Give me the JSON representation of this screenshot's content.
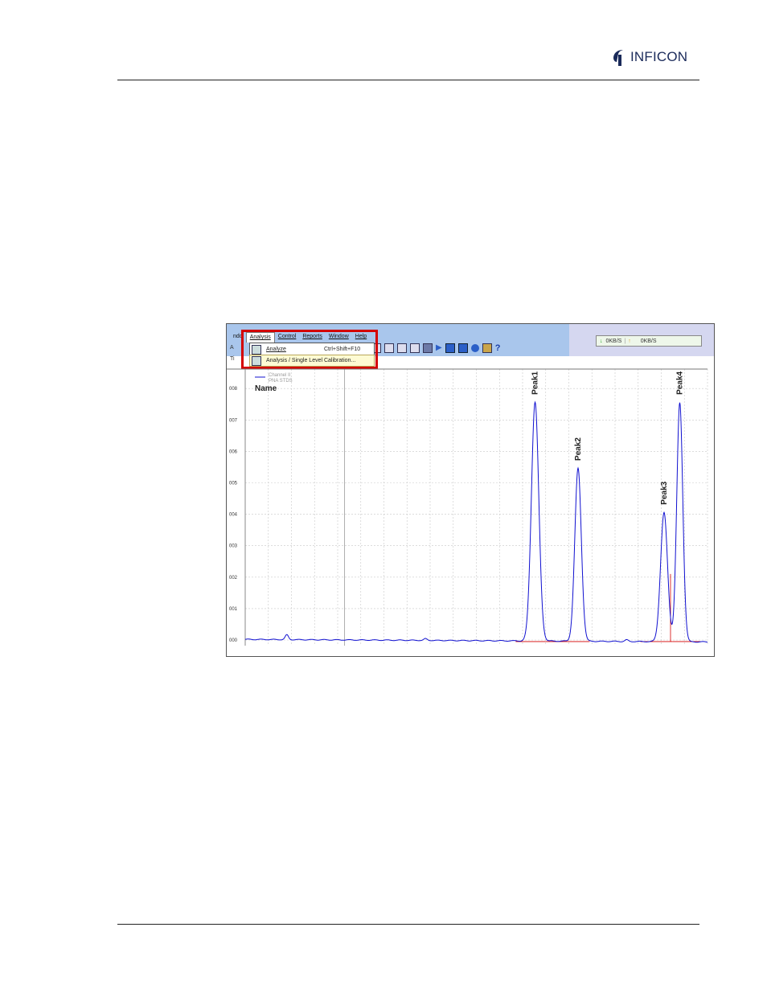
{
  "header": {
    "logo_text": "INFICON",
    "colors": {
      "logo_mark": "#1a2a5a",
      "rule": "#222222"
    }
  },
  "screenshot": {
    "menu": {
      "partial_left": "ndo",
      "items": [
        "Analysis",
        "Control",
        "Reports",
        "Window",
        "Help"
      ],
      "active_index": 0
    },
    "dropdown": {
      "items": [
        {
          "label": "Analyze",
          "shortcut": "Ctrl+Shift+F10",
          "icon": "analyze-icon"
        },
        {
          "label": "Analysis / Single Level Calibration...",
          "shortcut": "",
          "icon": "calibration-icon"
        }
      ],
      "selected_index": 1
    },
    "side_fragments": [
      "A",
      "Ti"
    ],
    "status": {
      "down_rate": "0KB/S",
      "up_rate": "0KB/S",
      "down_icon": "down-arrow-icon",
      "up_icon": "up-arrow-icon"
    },
    "colors": {
      "menubar_bg": "#a9c6ec",
      "highlight_box": "#d40000",
      "trace": "#1010d0",
      "baseline": "#d40000"
    }
  },
  "chart_data": {
    "type": "line",
    "legend": {
      "channel": "Channel II",
      "sample": "PNA STDS",
      "name_label": "Name"
    },
    "y_tick_labels": [
      "000",
      "001",
      "002",
      "003",
      "004",
      "005",
      "006",
      "007",
      "008"
    ],
    "ylim": [
      0,
      8.3
    ],
    "xlim": [
      0,
      100
    ],
    "grid": true,
    "peaks": [
      {
        "label": "Peak1",
        "x": 62.7,
        "height": 7.6,
        "width": 0.8
      },
      {
        "label": "Peak2",
        "x": 72.0,
        "height": 5.5,
        "width": 0.7
      },
      {
        "label": "Peak3",
        "x": 90.6,
        "height": 4.1,
        "width": 0.75
      },
      {
        "label": "Peak4",
        "x": 94.0,
        "height": 7.6,
        "width": 0.65
      }
    ],
    "small_bumps": [
      {
        "x": 9.0,
        "height": 0.15
      },
      {
        "x": 39.0,
        "height": 0.05
      },
      {
        "x": 82.5,
        "height": 0.05
      }
    ]
  }
}
